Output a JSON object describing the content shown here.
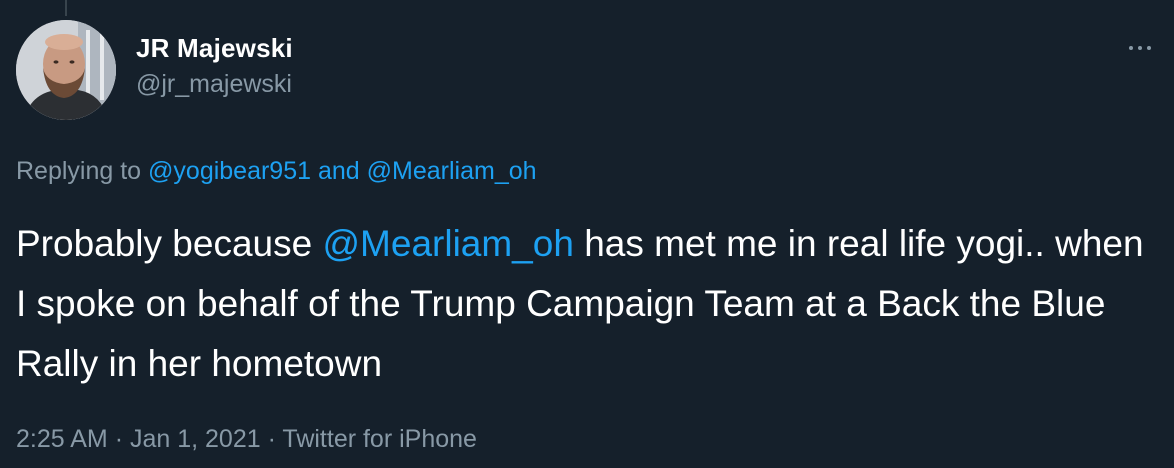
{
  "tweet": {
    "author": {
      "display_name": "JR Majewski",
      "handle": "@jr_majewski"
    },
    "more_icon": "ellipsis-icon",
    "reply_context": {
      "prefix": "Replying to",
      "mention_1": "@yogibear951",
      "conjunction": "and",
      "mention_2": "@Mearliam_oh"
    },
    "body": {
      "before_mention": "Probably because ",
      "mention": "@Mearliam_oh",
      "after_mention": " has met me in real life yogi.. when I spoke on behalf of the Trump Campaign Team at a Back the Blue Rally in her hometown"
    },
    "meta": {
      "time": "2:25 AM",
      "separator": "·",
      "date": "Jan 1, 2021",
      "source": "Twitter for iPhone"
    }
  },
  "colors": {
    "background": "#15202b",
    "text_primary": "#ffffff",
    "text_secondary": "#8899a6",
    "link": "#1da1f2"
  }
}
